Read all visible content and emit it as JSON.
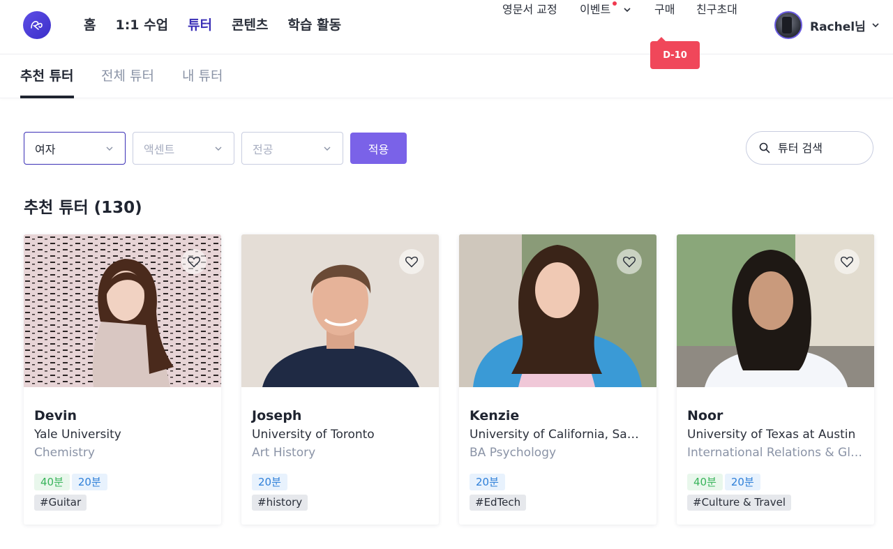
{
  "nav": {
    "main": [
      "홈",
      "1:1 수업",
      "튜터",
      "콘텐츠",
      "학습 활동"
    ],
    "active_index": 2,
    "proofread": "영문서 교정",
    "event": "이벤트",
    "buy": "구매",
    "invite": "친구초대",
    "countdown_badge": "D-10",
    "username": "Rachel님"
  },
  "subtabs": {
    "recommended": "추천 튜터",
    "all": "전체 튜터",
    "mine": "내 튜터"
  },
  "filters": {
    "gender": "여자",
    "accent_placeholder": "액센트",
    "major_placeholder": "전공",
    "apply": "적용",
    "search_placeholder": "튜터 검색"
  },
  "section_title": "추천 튜터 (130)",
  "tutors": [
    {
      "name": "Devin",
      "university": "Yale University",
      "major": "Chemistry",
      "lessons": [
        "40분",
        "20분"
      ],
      "tag": "#Guitar"
    },
    {
      "name": "Joseph",
      "university": "University of Toronto",
      "major": "Art History",
      "lessons": [
        "20분"
      ],
      "tag": "#history"
    },
    {
      "name": "Kenzie",
      "university": "University of California, Santa Barbara",
      "major": "BA Psychology",
      "lessons": [
        "20분"
      ],
      "tag": "#EdTech"
    },
    {
      "name": "Noor",
      "university": "University of Texas at Austin",
      "major": "International Relations & Global Studies",
      "lessons": [
        "40분",
        "20분"
      ],
      "tag": "#Culture & Travel"
    }
  ],
  "colors": {
    "accent": "#3a2fb6",
    "apply_button": "#7a62e8",
    "badge": "#f0475a",
    "pill_40": "#38b45a",
    "pill_20": "#2e7fd8"
  }
}
